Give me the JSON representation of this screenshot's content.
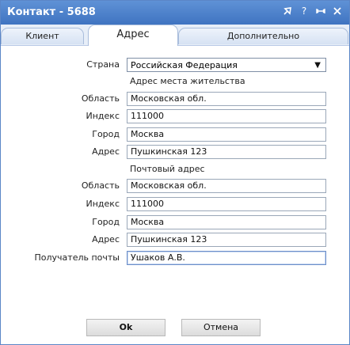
{
  "window": {
    "title": "Контакт - 5688"
  },
  "tabs": [
    {
      "label": "Клиент"
    },
    {
      "label": "Адрес"
    },
    {
      "label": "Дополнительно"
    }
  ],
  "form": {
    "country_label": "Страна",
    "country_value": "Российская Федерация",
    "residence_section": "Адрес места жительства",
    "residence": {
      "region_label": "Область",
      "region_value": "Московская обл.",
      "index_label": "Индекс",
      "index_value": "111000",
      "city_label": "Город",
      "city_value": "Москва",
      "address_label": "Адрес",
      "address_value": "Пушкинская 123"
    },
    "postal_section": "Почтовый адрес",
    "postal": {
      "region_label": "Область",
      "region_value": "Московская обл.",
      "index_label": "Индекс",
      "index_value": "111000",
      "city_label": "Город",
      "city_value": "Москва",
      "address_label": "Адрес",
      "address_value": "Пушкинская 123",
      "recipient_label": "Получатель почты",
      "recipient_value": "Ушаков А.В."
    }
  },
  "buttons": {
    "ok": "Ok",
    "cancel": "Отмена"
  },
  "icons": {
    "pin": "pin-icon",
    "help": "question-icon",
    "resize": "resize-icon",
    "close": "close-icon"
  },
  "colors": {
    "titlebar": "#4a7fc8",
    "tab_background": "#d6e2f3"
  }
}
